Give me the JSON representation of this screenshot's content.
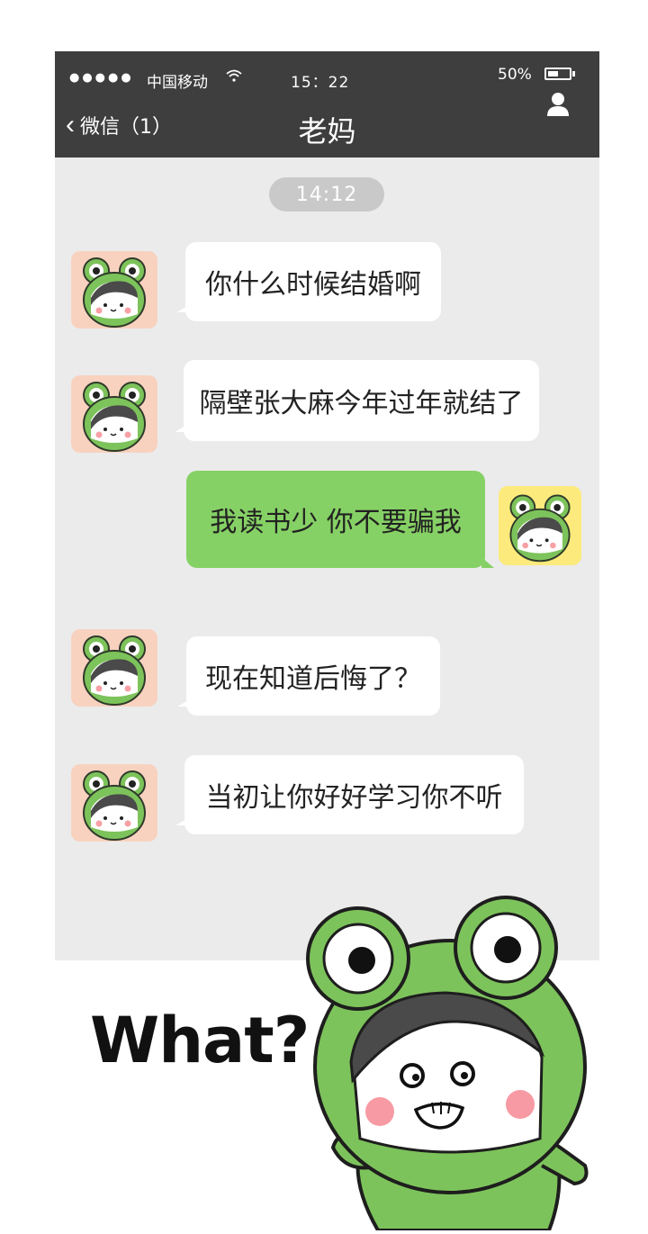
{
  "status_bar": {
    "signal_dots": "●●●●●",
    "carrier": "中国移动",
    "wifi_icon": "wifi-icon",
    "time": "15：22",
    "battery_percent": "50%",
    "battery_level": 0.5
  },
  "nav": {
    "back_label": "微信（1）",
    "title": "老妈",
    "profile_icon": "person-icon"
  },
  "chat": {
    "timestamp": "14:12",
    "messages": [
      {
        "sender": "mom",
        "text": "你什么时候结婚啊"
      },
      {
        "sender": "mom",
        "text": "隔壁张大麻今年过年就结了"
      },
      {
        "sender": "me",
        "text": "我读书少 你不要骗我"
      },
      {
        "sender": "mom",
        "text": "现在知道后悔了？"
      },
      {
        "sender": "mom",
        "text": "当初让你好好学习你不听"
      }
    ]
  },
  "caption": {
    "text": "What?"
  },
  "colors": {
    "topbar": "#3e3e3e",
    "chat_bg": "#ebebeb",
    "bubble_mine": "#86d165",
    "bubble_theirs": "#ffffff",
    "avatar_mom_bg": "#f8d2bf",
    "avatar_me_bg": "#fcea7c",
    "frog_green": "#7dc35b"
  }
}
